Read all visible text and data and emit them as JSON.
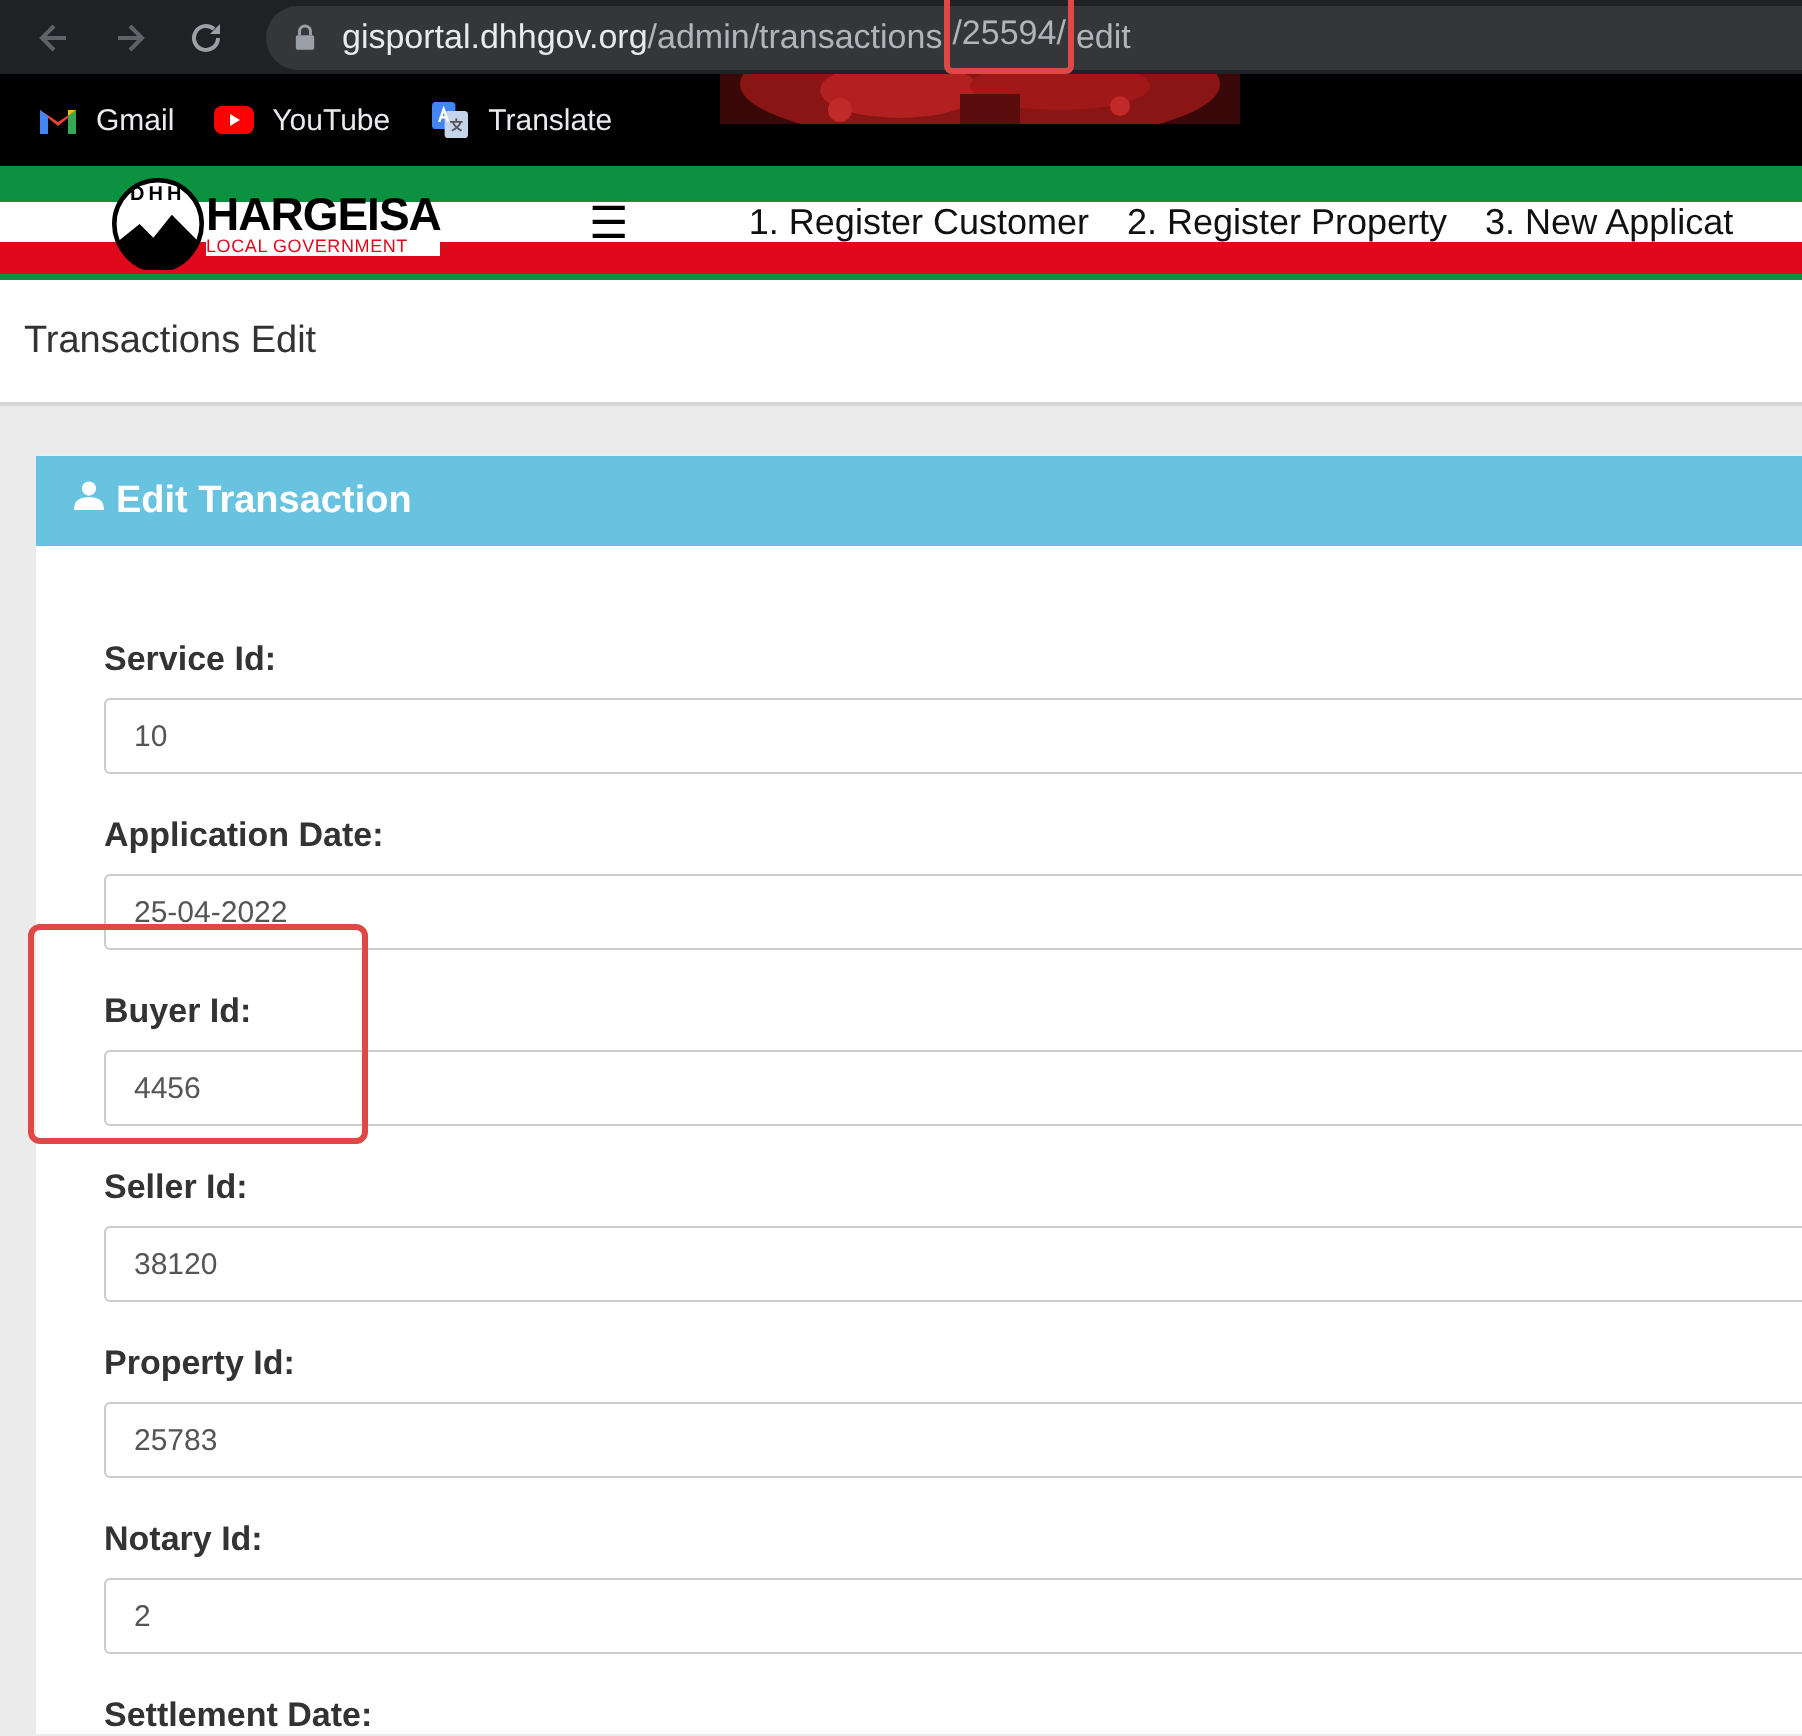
{
  "browser": {
    "url": [
      {
        "text": "gisportal.dhhgov.org",
        "kind": "host",
        "highlighted": false
      },
      {
        "text": "/admin/transactions",
        "kind": "path",
        "highlighted": false
      },
      {
        "text": "/25594/",
        "kind": "path",
        "highlighted": true
      },
      {
        "text": "edit",
        "kind": "path",
        "highlighted": false
      }
    ],
    "bookmarks": [
      {
        "label": "Gmail"
      },
      {
        "label": "YouTube"
      },
      {
        "label": "Translate"
      }
    ]
  },
  "header": {
    "logo_badge": "DHH",
    "logo_title": "HARGEISA",
    "logo_subtitle": "LOCAL GOVERNMENT",
    "menu_icon": "☰",
    "nav": [
      {
        "label": "1. Register Customer"
      },
      {
        "label": "2. Register Property"
      },
      {
        "label": "3. New Applicat"
      }
    ]
  },
  "page_title": "Transactions Edit",
  "card": {
    "title": "Edit Transaction",
    "fields": [
      {
        "label": "Service Id:",
        "value": "10",
        "highlighted": false
      },
      {
        "label": "Application Date:",
        "value": "25-04-2022",
        "highlighted": false
      },
      {
        "label": "Buyer Id:",
        "value": "4456",
        "highlighted": true
      },
      {
        "label": "Seller Id:",
        "value": "38120",
        "highlighted": false
      },
      {
        "label": "Property Id:",
        "value": "25783",
        "highlighted": false
      },
      {
        "label": "Notary Id:",
        "value": "2",
        "highlighted": false
      },
      {
        "label": "Settlement Date:",
        "highlighted": false
      }
    ]
  }
}
